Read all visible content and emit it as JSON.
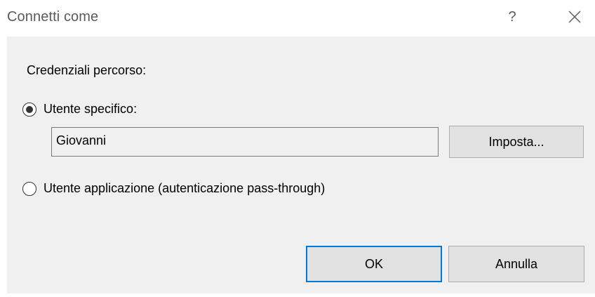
{
  "window": {
    "title": "Connetti come",
    "help_label": "?",
    "close_icon": "close-icon"
  },
  "credentials": {
    "section_label": "Credenziali percorso:",
    "specific_user": {
      "label": "Utente specifico:",
      "selected": true,
      "username_value": "Giovanni",
      "set_button_label": "Imposta..."
    },
    "application_user": {
      "label": "Utente applicazione (autenticazione pass-through)",
      "selected": false
    }
  },
  "footer": {
    "ok_label": "OK",
    "cancel_label": "Annulla"
  },
  "colors": {
    "content_background": "#f0f0f0",
    "button_background": "#e1e1e1",
    "default_button_border": "#0078d7"
  }
}
